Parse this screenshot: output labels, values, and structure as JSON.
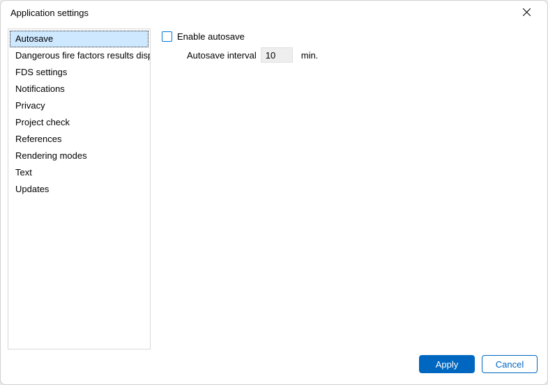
{
  "window": {
    "title": "Application settings"
  },
  "sidebar": {
    "items": [
      {
        "label": "Autosave",
        "selected": true
      },
      {
        "label": "Dangerous fire factors results display",
        "selected": false
      },
      {
        "label": "FDS settings",
        "selected": false
      },
      {
        "label": "Notifications",
        "selected": false
      },
      {
        "label": "Privacy",
        "selected": false
      },
      {
        "label": "Project check",
        "selected": false
      },
      {
        "label": "References",
        "selected": false
      },
      {
        "label": "Rendering modes",
        "selected": false
      },
      {
        "label": "Text",
        "selected": false
      },
      {
        "label": "Updates",
        "selected": false
      }
    ]
  },
  "content": {
    "enable_autosave_label": "Enable autosave",
    "enable_autosave_checked": false,
    "interval_label": "Autosave interval",
    "interval_value": "10",
    "interval_unit": "min."
  },
  "footer": {
    "apply_label": "Apply",
    "cancel_label": "Cancel"
  }
}
